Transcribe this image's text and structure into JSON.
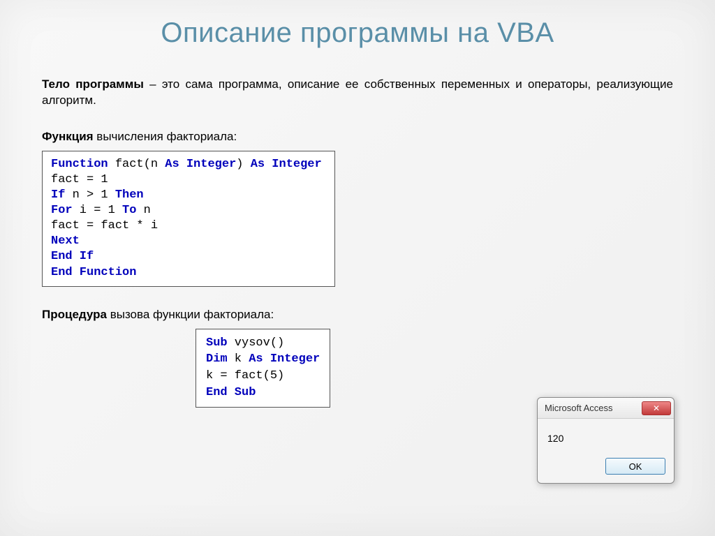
{
  "title": "Описание программы на VBA",
  "bodyBold": "Тело программы",
  "bodyRest": " – это сама программа, описание ее собственных переменных и операторы, реализующие алгоритм.",
  "label1Bold": "Функция",
  "label1Rest": " вычисления факториала:",
  "code1": {
    "l1a": "Function",
    "l1b": " fact(n ",
    "l1c": "As Integer",
    "l1d": ") ",
    "l1e": "As Integer",
    "l2": "fact = 1",
    "l3a": "If",
    "l3b": "  n > 1  ",
    "l3c": "Then",
    "l4a": "   ",
    "l4b": "For",
    "l4c": " i = 1 ",
    "l4d": "To",
    "l4e": " n",
    "l5": "         fact = fact * i",
    "l6a": "   ",
    "l6b": "Next",
    "l7": "End If",
    "l8": "End Function"
  },
  "label2Bold": "Процедура",
  "label2Rest": " вызова функции факториала:",
  "code2": {
    "l1a": "Sub",
    "l1b": " vysov()",
    "l2a": "Dim",
    "l2b": " k ",
    "l2c": "As Integer",
    "l3": "k = fact(5)",
    "l4": "End Sub"
  },
  "dialog": {
    "title": "Microsoft Access",
    "value": "120",
    "ok": "OK",
    "closeGlyph": "✕"
  }
}
